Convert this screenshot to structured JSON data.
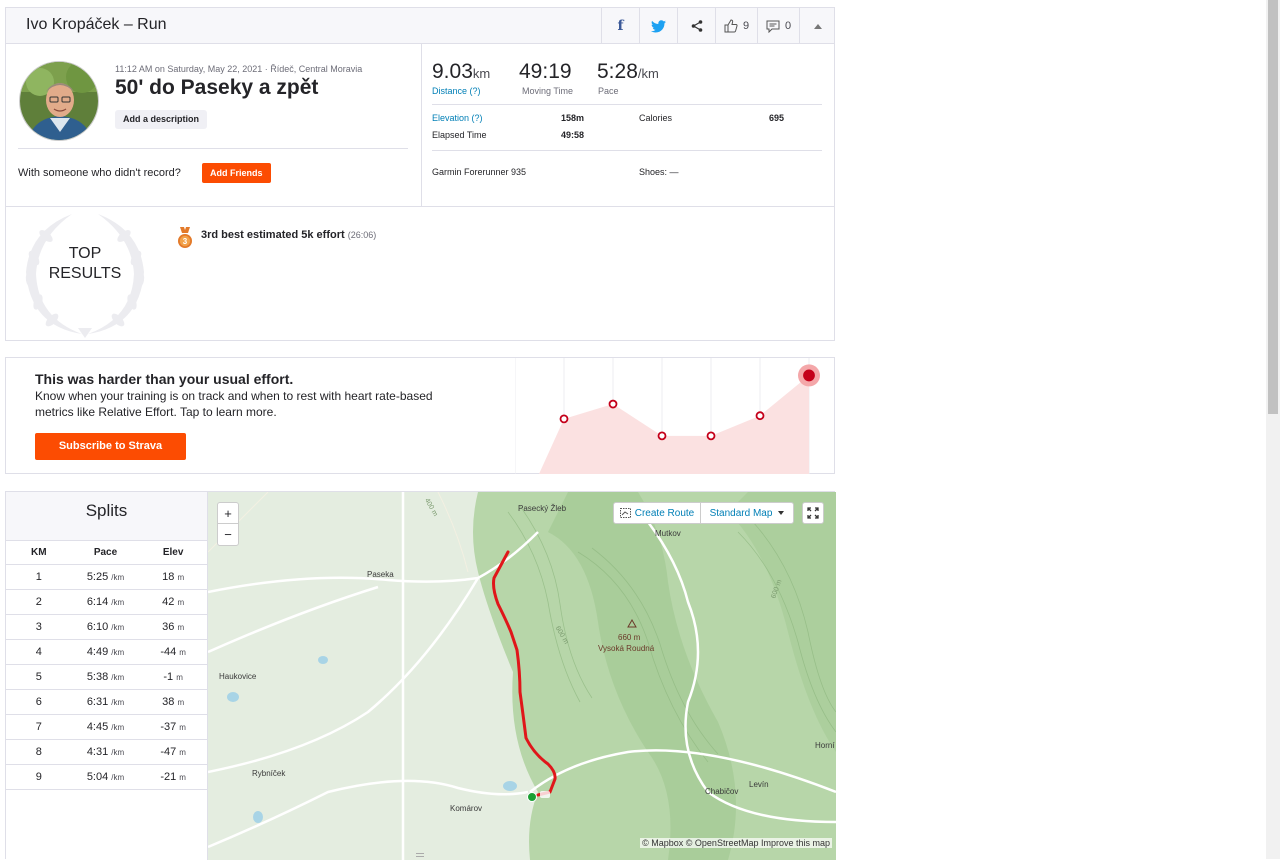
{
  "header": {
    "title": "Ivo Kropáček – Run",
    "kudos_count": "9",
    "comments_count": "0"
  },
  "activity": {
    "meta": "11:12 AM on Saturday, May 22, 2021 · Řídeč, Central Moravia",
    "title": "50' do Paseky a zpět",
    "add_description": "Add a description",
    "with_someone": "With someone who didn't record?",
    "add_friends": "Add Friends"
  },
  "stats": {
    "distance_value": "9.03",
    "distance_unit": "km",
    "distance_label": "Distance (?)",
    "moving_time_value": "49:19",
    "moving_time_label": "Moving Time",
    "pace_value": "5:28",
    "pace_unit": "/km",
    "pace_label": "Pace",
    "elevation_label": "Elevation (?)",
    "elevation_value": "158m",
    "elapsed_label": "Elapsed Time",
    "elapsed_value": "49:58",
    "calories_label": "Calories",
    "calories_value": "695",
    "device": "Garmin Forerunner 935",
    "shoes_label": "Shoes: —"
  },
  "top_results": {
    "heading_line1": "TOP",
    "heading_line2": "RESULTS",
    "medal_rank": "3",
    "achievement": "3rd best estimated 5k effort",
    "achievement_time": "(26:06)"
  },
  "effort": {
    "heading": "This was harder than your usual effort.",
    "text": "Know when your training is on track and when to rest with heart rate-based metrics like Relative Effort. Tap to learn more.",
    "button": "Subscribe to Strava",
    "relative_levels": [
      0.52,
      0.66,
      0.36,
      0.36,
      0.55,
      0.93
    ]
  },
  "splits": {
    "title": "Splits",
    "headers": [
      "KM",
      "Pace",
      "Elev"
    ],
    "pace_unit": "/km",
    "elev_unit": "m",
    "rows": [
      {
        "km": "1",
        "pace": "5:25",
        "elev": "18"
      },
      {
        "km": "2",
        "pace": "6:14",
        "elev": "42"
      },
      {
        "km": "3",
        "pace": "6:10",
        "elev": "36"
      },
      {
        "km": "4",
        "pace": "4:49",
        "elev": "-44"
      },
      {
        "km": "5",
        "pace": "5:38",
        "elev": "-1"
      },
      {
        "km": "6",
        "pace": "6:31",
        "elev": "38"
      },
      {
        "km": "7",
        "pace": "4:45",
        "elev": "-37"
      },
      {
        "km": "8",
        "pace": "4:31",
        "elev": "-47"
      },
      {
        "km": "9",
        "pace": "5:04",
        "elev": "-21"
      }
    ]
  },
  "map": {
    "zoom_in": "+",
    "zoom_out": "−",
    "create_route": "Create Route",
    "map_style": "Standard Map",
    "attribution": "© Mapbox © OpenStreetMap Improve this map",
    "labels": {
      "pasecky": "Pasecký Žleb",
      "mutkov": "Mutkov",
      "paseka": "Paseka",
      "peak_elev": "660 m",
      "peak_name": "Vysoká Roudná",
      "haukovice": "Haukovice",
      "rybnicek": "Rybníček",
      "komarov": "Komárov",
      "chabicov": "Chabičov",
      "levin": "Levín",
      "horni": "Horní",
      "c400": "400 m",
      "c600a": "600 m",
      "c600b": "600 m"
    }
  },
  "colors": {
    "accent": "#fc4c02",
    "link": "#007fb6",
    "route": "#e0161a",
    "start": "#1a9f33"
  }
}
